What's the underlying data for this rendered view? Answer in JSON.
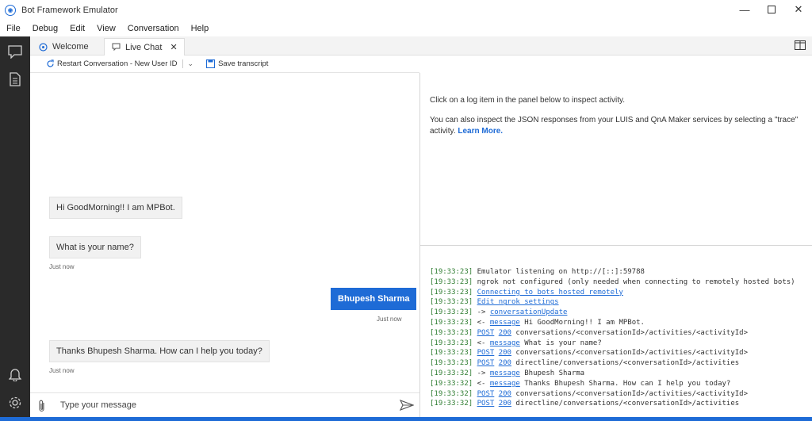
{
  "window": {
    "title": "Bot Framework Emulator"
  },
  "menu": [
    "File",
    "Debug",
    "Edit",
    "View",
    "Conversation",
    "Help"
  ],
  "tabs": [
    {
      "label": "Welcome"
    },
    {
      "label": "Live Chat"
    }
  ],
  "toolbar": {
    "restart_label": "Restart Conversation - New User ID",
    "save_label": "Save transcript"
  },
  "chat": {
    "messages": [
      {
        "from": "bot",
        "text": "Hi GoodMorning!! I am MPBot."
      },
      {
        "from": "bot",
        "text": "What is your name?",
        "timestamp": "Just now"
      },
      {
        "from": "user",
        "text": "Bhupesh Sharma",
        "timestamp": "Just now"
      },
      {
        "from": "bot",
        "text": "Thanks Bhupesh Sharma. How can I help you today?",
        "timestamp": "Just now"
      }
    ],
    "input_placeholder": "Type your message"
  },
  "inspector": {
    "line1": "Click on a log item in the panel below to inspect activity.",
    "line2": "You can also inspect the JSON responses from your LUIS and QnA Maker services by selecting a \"trace\" activity.",
    "learn_more": "Learn More."
  },
  "log": [
    {
      "time": "[19:33:23]",
      "text": "Emulator listening on http://[::]:59788"
    },
    {
      "time": "[19:33:23]",
      "text": "ngrok not configured (only needed when connecting to remotely hosted bots)"
    },
    {
      "time": "[19:33:23]",
      "link": "Connecting to bots hosted remotely"
    },
    {
      "time": "[19:33:23]",
      "link": "Edit ngrok settings"
    },
    {
      "time": "[19:33:23]",
      "prefix": "->",
      "link": "conversationUpdate"
    },
    {
      "time": "[19:33:23]",
      "prefix": "<-",
      "link": "message",
      "text": "Hi GoodMorning!! I am MPBot."
    },
    {
      "time": "[19:33:23]",
      "link": "POST",
      "link2": "200",
      "text": "conversations/<conversationId>/activities/<activityId>"
    },
    {
      "time": "[19:33:23]",
      "prefix": "<-",
      "link": "message",
      "text": "What is your name?"
    },
    {
      "time": "[19:33:23]",
      "link": "POST",
      "link2": "200",
      "text": "conversations/<conversationId>/activities/<activityId>"
    },
    {
      "time": "[19:33:23]",
      "link": "POST",
      "link2": "200",
      "text": "directline/conversations/<conversationId>/activities"
    },
    {
      "time": "[19:33:32]",
      "prefix": "->",
      "link": "message",
      "text": "Bhupesh Sharma"
    },
    {
      "time": "[19:33:32]",
      "prefix": "<-",
      "link": "message",
      "text": "Thanks Bhupesh Sharma. How can I help you today?"
    },
    {
      "time": "[19:33:32]",
      "link": "POST",
      "link2": "200",
      "text": "conversations/<conversationId>/activities/<activityId>"
    },
    {
      "time": "[19:33:32]",
      "link": "POST",
      "link2": "200",
      "text": "directline/conversations/<conversationId>/activities"
    }
  ]
}
